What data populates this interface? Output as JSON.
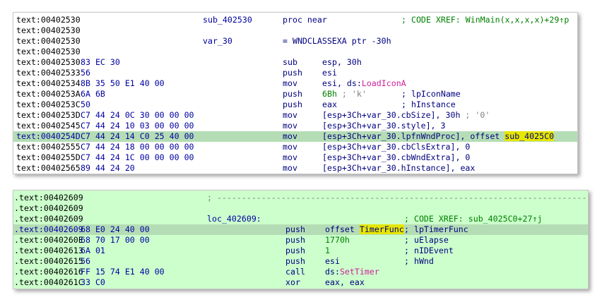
{
  "panel_top": {
    "rows": [
      {
        "addr": "text:00402530",
        "bytes": "",
        "label": "sub_402530",
        "mn": "proc near",
        "ops": "",
        "comment": "; CODE XREF: WinMain(x,x,x,x)+29↑p"
      },
      {
        "addr": "text:00402530",
        "bytes": "",
        "label": "",
        "mn": "",
        "ops": "",
        "comment": ""
      },
      {
        "addr": "text:00402530",
        "bytes": "",
        "label": "var_30",
        "mn": "= WNDCLASSEXA ptr -30h",
        "ops": "",
        "comment": ""
      },
      {
        "addr": "text:00402530",
        "bytes": "",
        "label": "",
        "mn": "",
        "ops": "",
        "comment": ""
      },
      {
        "addr": "text:00402530",
        "bytes": "83 EC 30",
        "label": "",
        "mn": "sub",
        "ops": "esp, 30h",
        "comment": ""
      },
      {
        "addr": "text:00402533",
        "bytes": "56",
        "label": "",
        "mn": "push",
        "ops": "esi",
        "comment": ""
      },
      {
        "addr": "text:00402534",
        "bytes": "8B 35 50 E1 40 00",
        "label": "",
        "mn": "mov",
        "ops": "esi, ds:",
        "ops_import": "LoadIconA",
        "comment": ""
      },
      {
        "addr": "text:0040253A",
        "bytes": "6A 6B",
        "label": "",
        "mn": "push",
        "ops": "6Bh",
        "ops_comment": " ; 'k'",
        "comment": "; lpIconName"
      },
      {
        "addr": "text:0040253C",
        "bytes": "50",
        "label": "",
        "mn": "push",
        "ops": "eax",
        "comment": "; hInstance"
      },
      {
        "addr": "text:0040253D",
        "bytes": "C7 44 24 0C 30 00 00 00",
        "label": "",
        "mn": "mov",
        "ops": "[esp+3Ch+var_30.cbSize], 30h",
        "ops_comment": " ; '0'",
        "comment": ""
      },
      {
        "addr": "text:00402545",
        "bytes": "C7 44 24 10 03 00 00 00",
        "label": "",
        "mn": "mov",
        "ops": "[esp+3Ch+var_30.style], 3",
        "comment": ""
      },
      {
        "addr": "text:0040254D",
        "bytes": "C7 44 24 14 C0 25 40 00",
        "label": "",
        "mn": "mov",
        "ops": "[esp+3Ch+var_30.lpfnWndProc], offset ",
        "ops_hl": "sub_4025C0",
        "comment": "",
        "highlight": true
      },
      {
        "addr": "text:00402555",
        "bytes": "C7 44 24 18 00 00 00 00",
        "label": "",
        "mn": "mov",
        "ops": "[esp+3Ch+var_30.cbClsExtra], 0",
        "comment": ""
      },
      {
        "addr": "text:0040255D",
        "bytes": "C7 44 24 1C 00 00 00 00",
        "label": "",
        "mn": "mov",
        "ops": "[esp+3Ch+var_30.cbWndExtra], 0",
        "comment": ""
      },
      {
        "addr": "text:00402565",
        "bytes": "89 44 24 20",
        "label": "",
        "mn": "mov",
        "ops": "[esp+3Ch+var_30.hInstance], eax",
        "comment": ""
      }
    ]
  },
  "panel_bottom": {
    "rows": [
      {
        "addr": ".text:00402609",
        "bytes": "",
        "label": "",
        "mn": "",
        "ops": "",
        "comment": "",
        "separator": "; ---------------------------------------------------------------------------"
      },
      {
        "addr": ".text:00402609",
        "bytes": "",
        "label": "",
        "mn": "",
        "ops": "",
        "comment": ""
      },
      {
        "addr": ".text:00402609",
        "bytes": "",
        "label": "loc_402609:",
        "mn": "",
        "ops": "",
        "comment": "; CODE XREF: sub_4025C0+27↑j"
      },
      {
        "addr": ".text:00402609",
        "bytes": "68 E0 24 40 00",
        "label": "",
        "mn": "push",
        "ops": "offset ",
        "ops_hl": "TimerFunc",
        "comment": "; lpTimerFunc",
        "highlight": true
      },
      {
        "addr": ".text:0040260E",
        "bytes": "68 70 17 00 00",
        "label": "",
        "mn": "push",
        "ops": "1770h",
        "comment": "; uElapse"
      },
      {
        "addr": ".text:00402613",
        "bytes": "6A 01",
        "label": "",
        "mn": "push",
        "ops": "1",
        "comment": "; nIDEvent"
      },
      {
        "addr": ".text:00402615",
        "bytes": "56",
        "label": "",
        "mn": "push",
        "ops": "esi",
        "comment": "; hWnd"
      },
      {
        "addr": ".text:00402616",
        "bytes": "FF 15 74 E1 40 00",
        "label": "",
        "mn": "call",
        "ops": "ds:",
        "ops_import": "SetTimer",
        "comment": ""
      },
      {
        "addr": ".text:0040261C",
        "bytes": "33 C0",
        "label": "",
        "mn": "xor",
        "ops": "eax, eax",
        "comment": ""
      }
    ]
  },
  "colors": {
    "top_bg": "#ffffff",
    "bottom_bg": "#ccffcc",
    "highlight_line": "#b5ddb5",
    "highlight_word": "#e6e600",
    "import_name": "#d0209a"
  }
}
